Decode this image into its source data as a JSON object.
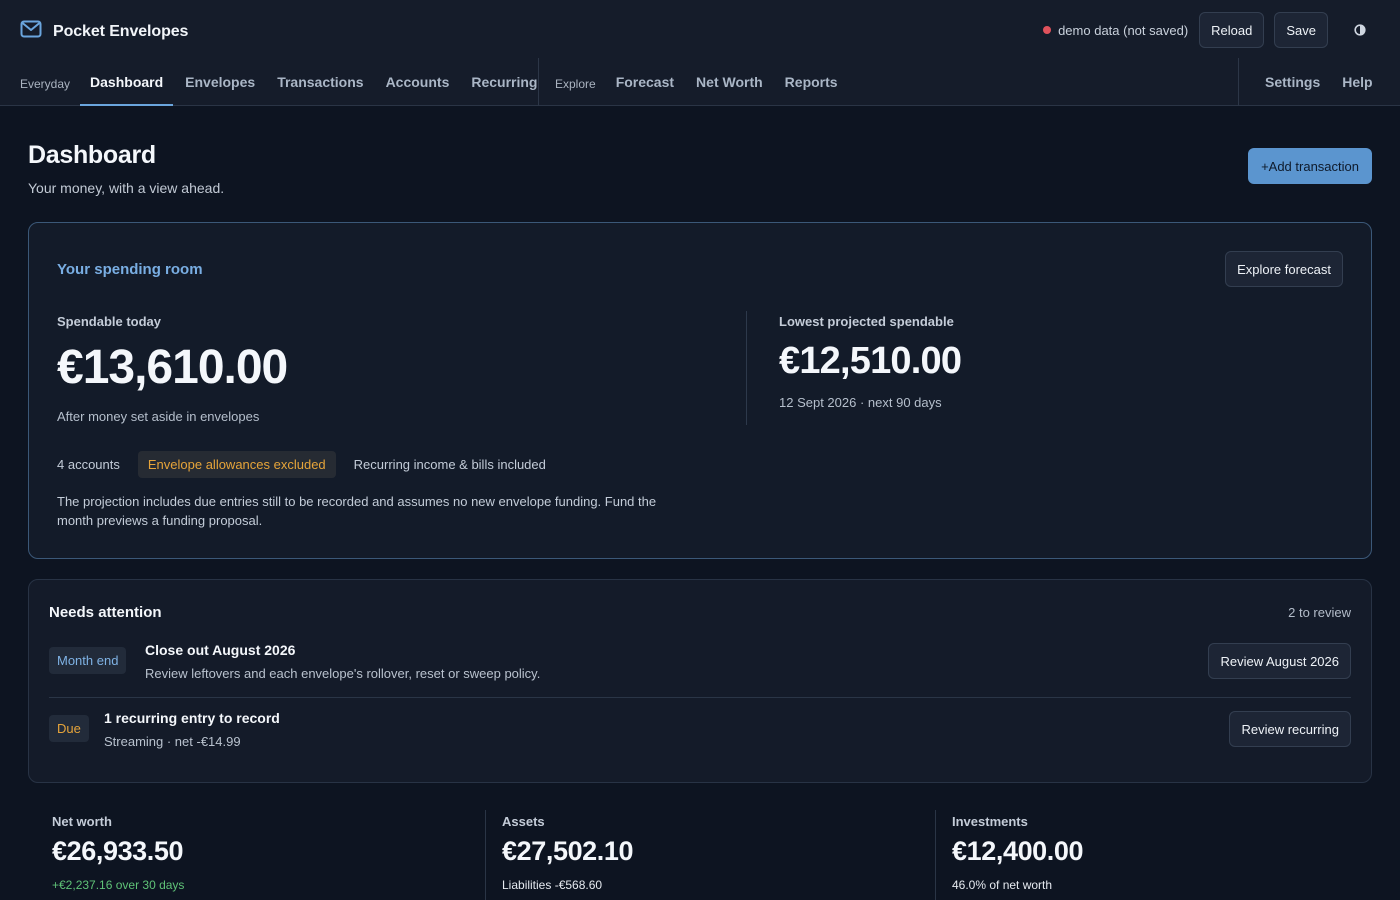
{
  "app": {
    "name": "Pocket Envelopes"
  },
  "header": {
    "status_text": "demo data (not saved)",
    "reload_label": "Reload",
    "save_label": "Save"
  },
  "nav": {
    "everyday_caption": "Everyday",
    "everyday_items": [
      {
        "label": "Dashboard",
        "active": true
      },
      {
        "label": "Envelopes"
      },
      {
        "label": "Transactions"
      },
      {
        "label": "Accounts"
      },
      {
        "label": "Recurring"
      }
    ],
    "explore_caption": "Explore",
    "explore_items": [
      {
        "label": "Forecast"
      },
      {
        "label": "Net Worth"
      },
      {
        "label": "Reports"
      }
    ],
    "utility_items": [
      {
        "label": "Settings"
      },
      {
        "label": "Help"
      }
    ]
  },
  "page": {
    "title": "Dashboard",
    "subtitle": "Your money, with a view ahead.",
    "add_transaction_label": "+Add transaction"
  },
  "spending": {
    "title": "Your spending room",
    "explore_button": "Explore forecast",
    "today_label": "Spendable today",
    "today_amount": "€13,610.00",
    "today_note": "After money set aside in envelopes",
    "lowest_label": "Lowest projected spendable",
    "lowest_amount": "€12,510.00",
    "lowest_note": "12 Sept 2026 · next 90 days",
    "accounts_chip": "4 accounts",
    "allowances_chip": "Envelope allowances excluded",
    "recurring_chip": "Recurring income & bills included",
    "note": "The projection includes due entries still to be recorded and assumes no new envelope funding. Fund the month previews a funding proposal."
  },
  "attention": {
    "title": "Needs attention",
    "count_text": "2 to review",
    "items": [
      {
        "tag": "Month end",
        "heading": "Close out August 2026",
        "sub": "Review leftovers and each envelope's rollover, reset or sweep policy.",
        "button": "Review August 2026"
      },
      {
        "tag": "Due",
        "heading": "1 recurring entry to record",
        "sub": "Streaming · net -€14.99",
        "button": "Review recurring"
      }
    ]
  },
  "stats": [
    {
      "label": "Net worth",
      "value": "€26,933.50",
      "sub": "+€2,237.16 over 30 days"
    },
    {
      "label": "Assets",
      "value": "€27,502.10",
      "sub": "Liabilities -€568.60"
    },
    {
      "label": "Investments",
      "value": "€12,400.00",
      "sub": "46.0% of net worth"
    }
  ],
  "colors": {
    "accent": "#6aa5dd",
    "primary_button": "#5b95cf",
    "warning": "#e6a43a",
    "positive": "#5fc277",
    "status_dot": "#e0525c"
  },
  "icons": {
    "brand": "envelope-icon",
    "theme": "contrast-icon"
  }
}
